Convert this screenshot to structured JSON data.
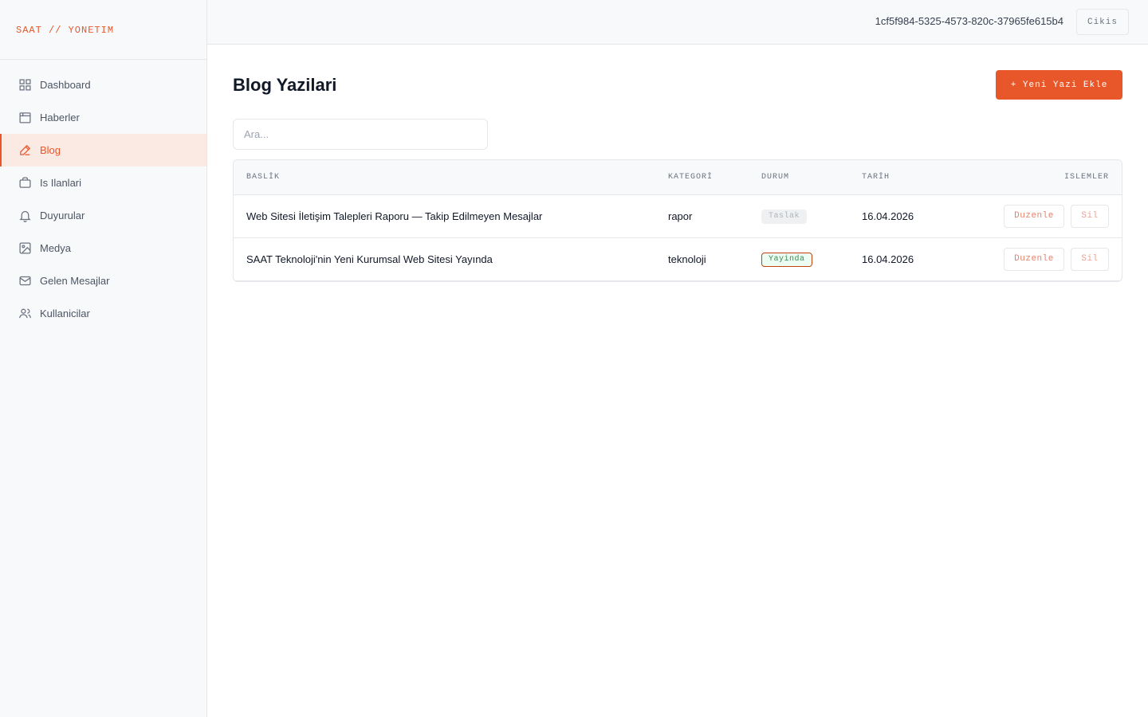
{
  "brand": "SAAT // YONETIM",
  "sidebar": {
    "items": [
      {
        "label": "Dashboard",
        "icon": "grid-icon",
        "active": false
      },
      {
        "label": "Haberler",
        "icon": "newspaper-icon",
        "active": false
      },
      {
        "label": "Blog",
        "icon": "pen-icon",
        "active": true
      },
      {
        "label": "Is Ilanlari",
        "icon": "briefcase-icon",
        "active": false
      },
      {
        "label": "Duyurular",
        "icon": "bell-icon",
        "active": false
      },
      {
        "label": "Medya",
        "icon": "image-icon",
        "active": false
      },
      {
        "label": "Gelen Mesajlar",
        "icon": "mail-icon",
        "active": false
      },
      {
        "label": "Kullanicilar",
        "icon": "users-icon",
        "active": false
      }
    ]
  },
  "topbar": {
    "user_id": "1cf5f984-5325-4573-820c-37965fe615b4",
    "logout_label": "Cikis"
  },
  "page": {
    "title": "Blog Yazilari",
    "add_button_label": "+ Yeni Yazi Ekle",
    "search_placeholder": "Ara..."
  },
  "table": {
    "headers": {
      "title": "BASLİK",
      "category": "KATEGORİ",
      "status": "DURUM",
      "date": "TARİH",
      "actions": "ISLEMLER"
    },
    "rows": [
      {
        "title": "Web Sitesi İletişim Talepleri Raporu — Takip Edilmeyen Mesajlar",
        "category": "rapor",
        "status": "Taslak",
        "date": "16.04.2026",
        "edit_label": "Duzenle",
        "delete_label": "Sil"
      },
      {
        "title": "SAAT Teknoloji'nin Yeni Kurumsal Web Sitesi Yayında",
        "category": "teknoloji",
        "status": "Yayinda",
        "date": "16.04.2026",
        "edit_label": "Duzenle",
        "delete_label": "Sil"
      }
    ]
  },
  "colors": {
    "accent": "#e8572a",
    "active_bg": "#fbe9e3",
    "sidebar_bg": "#f8f9fb",
    "published_bg": "#ecfdf3",
    "draft_bg": "#eef0f2"
  }
}
